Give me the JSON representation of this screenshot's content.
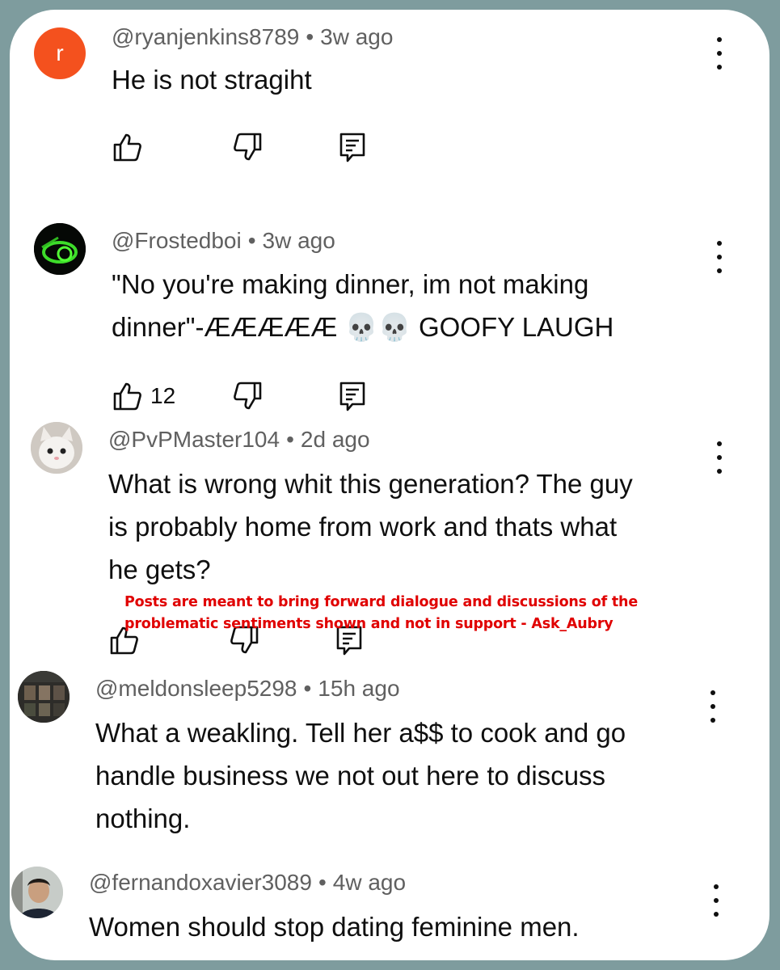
{
  "comments": [
    {
      "username": "@ryanjenkins8789",
      "time": "3w ago",
      "text": "He is not stragiht",
      "avatar_letter": "r",
      "likes": ""
    },
    {
      "username": "@Frostedboi",
      "time": "3w ago",
      "text": "\"No you're making dinner, im not making\ndinner\"-ÆÆÆÆÆ 💀💀 GOOFY LAUGH",
      "likes": "12"
    },
    {
      "username": "@PvPMaster104",
      "time": "2d ago",
      "text": "What is wrong whit this generation? The guy\nis probably home from work and thats what\nhe gets?",
      "likes": ""
    },
    {
      "username": "@meldonsleep5298",
      "time": "15h ago",
      "text": "What a weakling. Tell her a$$ to cook and go\nhandle business we not out here to discuss\nnothing."
    },
    {
      "username": "@fernandoxavier3089",
      "time": "4w ago",
      "text": "Women should stop dating feminine men."
    }
  ],
  "separator": "•",
  "notice": "Posts are meant to bring forward dialogue and discussions of the problematic sentiments shown and not in support - Ask_Aubry",
  "colors": {
    "background": "#7e9c9e",
    "card": "#ffffff",
    "avatar_r": "#f4511e",
    "notice": "#e00000"
  },
  "icons": [
    "like-icon",
    "dislike-icon",
    "reply-icon",
    "more-vert-icon"
  ]
}
